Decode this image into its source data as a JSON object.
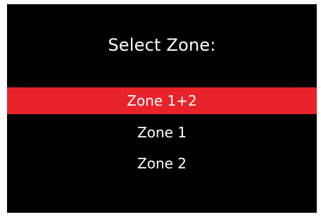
{
  "dialog": {
    "title": "Select Zone:"
  },
  "menu": {
    "items": [
      {
        "label": "Zone 1+2",
        "selected": true
      },
      {
        "label": "Zone 1",
        "selected": false
      },
      {
        "label": "Zone 2",
        "selected": false
      }
    ]
  },
  "colors": {
    "background": "#000000",
    "text": "#ffffff",
    "selection": "#e8232a"
  }
}
